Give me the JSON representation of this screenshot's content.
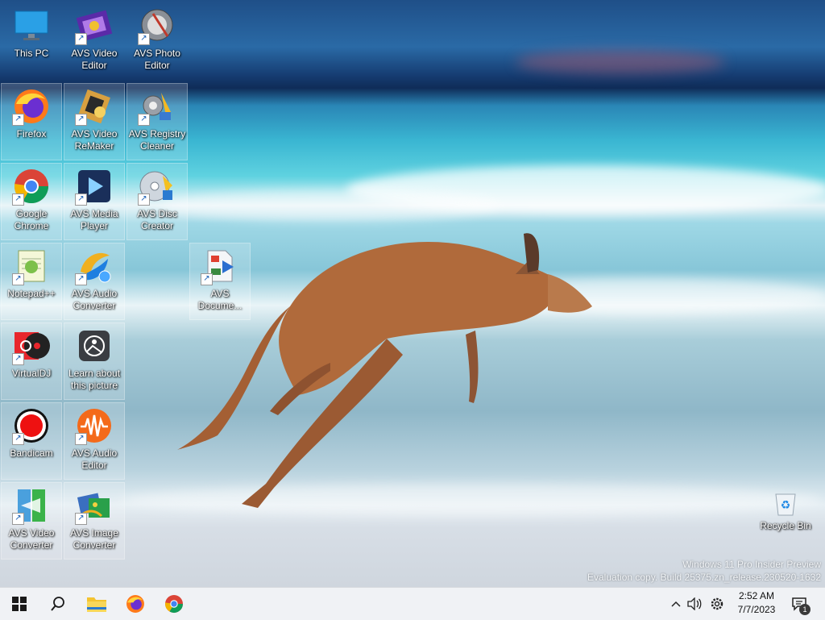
{
  "desktop": {
    "icons": [
      {
        "name": "this-pc",
        "label": "This PC"
      },
      {
        "name": "avs-video-editor",
        "label": "AVS Video Editor"
      },
      {
        "name": "avs-photo-editor",
        "label": "AVS Photo Editor"
      },
      {
        "name": "firefox",
        "label": "Firefox"
      },
      {
        "name": "avs-video-remaker",
        "label": "AVS Video ReMaker"
      },
      {
        "name": "avs-registry-cleaner",
        "label": "AVS Registry Cleaner"
      },
      {
        "name": "google-chrome",
        "label": "Google Chrome"
      },
      {
        "name": "avs-media-player",
        "label": "AVS Media Player"
      },
      {
        "name": "avs-disc-creator",
        "label": "AVS Disc Creator"
      },
      {
        "name": "notepad-plus-plus",
        "label": "Notepad++"
      },
      {
        "name": "avs-audio-converter",
        "label": "AVS Audio Converter"
      },
      {
        "name": "avs-document-converter",
        "label": "AVS Docume..."
      },
      {
        "name": "virtualdj",
        "label": "VirtualDJ"
      },
      {
        "name": "learn-about-this-picture",
        "label": "Learn about this picture"
      },
      {
        "name": "bandicam",
        "label": "Bandicam"
      },
      {
        "name": "avs-audio-editor",
        "label": "AVS Audio Editor"
      },
      {
        "name": "avs-video-converter",
        "label": "AVS Video Converter"
      },
      {
        "name": "avs-image-converter",
        "label": "AVS Image Converter"
      },
      {
        "name": "recycle-bin",
        "label": "Recycle Bin"
      }
    ],
    "shortcut_arrow": "↗"
  },
  "watermark": {
    "line1": "Windows 11 Pro Insider Preview",
    "line2": "Evaluation copy. Build 25375.zn_release.230520-1632"
  },
  "taskbar": {
    "clock_time": "2:52 AM",
    "clock_date": "7/7/2023",
    "notification_count": "1",
    "chevron": "^"
  },
  "colors": {
    "taskbar_bg": "#f0f2f5",
    "start_blue": "#1a1a1a",
    "folder_yellow": "#f4c330"
  }
}
